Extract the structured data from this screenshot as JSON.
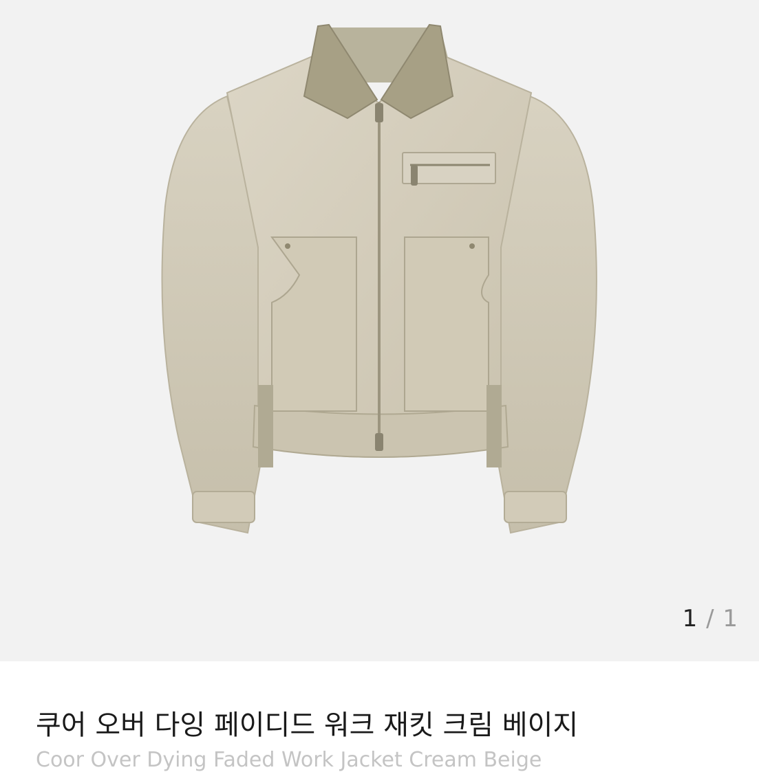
{
  "gallery": {
    "current_page": "1",
    "separator": "/",
    "total_pages": "1",
    "image_subject": "jacket-photo"
  },
  "product": {
    "title_ko": "쿠어 오버 다잉 페이디드 워크 재킷 크림 베이지",
    "title_en": "Coor Over Dying Faded Work Jacket Cream Beige"
  },
  "colors": {
    "gallery_bg": "#f2f2f2",
    "jacket_body": "#d6d0bf",
    "jacket_collar": "#a7a085",
    "title_text": "#1a1a1a",
    "subtitle_text": "#c4c4c4"
  }
}
